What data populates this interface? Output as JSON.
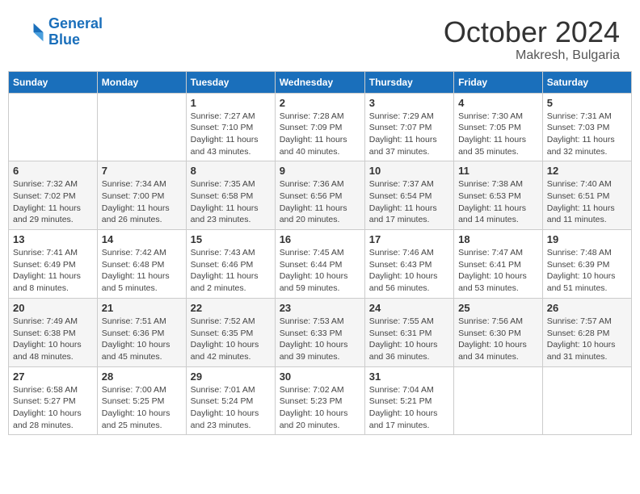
{
  "header": {
    "logo_line1": "General",
    "logo_line2": "Blue",
    "month": "October 2024",
    "location": "Makresh, Bulgaria"
  },
  "weekdays": [
    "Sunday",
    "Monday",
    "Tuesday",
    "Wednesday",
    "Thursday",
    "Friday",
    "Saturday"
  ],
  "weeks": [
    [
      {
        "day": "",
        "info": ""
      },
      {
        "day": "",
        "info": ""
      },
      {
        "day": "1",
        "info": "Sunrise: 7:27 AM\nSunset: 7:10 PM\nDaylight: 11 hours and 43 minutes."
      },
      {
        "day": "2",
        "info": "Sunrise: 7:28 AM\nSunset: 7:09 PM\nDaylight: 11 hours and 40 minutes."
      },
      {
        "day": "3",
        "info": "Sunrise: 7:29 AM\nSunset: 7:07 PM\nDaylight: 11 hours and 37 minutes."
      },
      {
        "day": "4",
        "info": "Sunrise: 7:30 AM\nSunset: 7:05 PM\nDaylight: 11 hours and 35 minutes."
      },
      {
        "day": "5",
        "info": "Sunrise: 7:31 AM\nSunset: 7:03 PM\nDaylight: 11 hours and 32 minutes."
      }
    ],
    [
      {
        "day": "6",
        "info": "Sunrise: 7:32 AM\nSunset: 7:02 PM\nDaylight: 11 hours and 29 minutes."
      },
      {
        "day": "7",
        "info": "Sunrise: 7:34 AM\nSunset: 7:00 PM\nDaylight: 11 hours and 26 minutes."
      },
      {
        "day": "8",
        "info": "Sunrise: 7:35 AM\nSunset: 6:58 PM\nDaylight: 11 hours and 23 minutes."
      },
      {
        "day": "9",
        "info": "Sunrise: 7:36 AM\nSunset: 6:56 PM\nDaylight: 11 hours and 20 minutes."
      },
      {
        "day": "10",
        "info": "Sunrise: 7:37 AM\nSunset: 6:54 PM\nDaylight: 11 hours and 17 minutes."
      },
      {
        "day": "11",
        "info": "Sunrise: 7:38 AM\nSunset: 6:53 PM\nDaylight: 11 hours and 14 minutes."
      },
      {
        "day": "12",
        "info": "Sunrise: 7:40 AM\nSunset: 6:51 PM\nDaylight: 11 hours and 11 minutes."
      }
    ],
    [
      {
        "day": "13",
        "info": "Sunrise: 7:41 AM\nSunset: 6:49 PM\nDaylight: 11 hours and 8 minutes."
      },
      {
        "day": "14",
        "info": "Sunrise: 7:42 AM\nSunset: 6:48 PM\nDaylight: 11 hours and 5 minutes."
      },
      {
        "day": "15",
        "info": "Sunrise: 7:43 AM\nSunset: 6:46 PM\nDaylight: 11 hours and 2 minutes."
      },
      {
        "day": "16",
        "info": "Sunrise: 7:45 AM\nSunset: 6:44 PM\nDaylight: 10 hours and 59 minutes."
      },
      {
        "day": "17",
        "info": "Sunrise: 7:46 AM\nSunset: 6:43 PM\nDaylight: 10 hours and 56 minutes."
      },
      {
        "day": "18",
        "info": "Sunrise: 7:47 AM\nSunset: 6:41 PM\nDaylight: 10 hours and 53 minutes."
      },
      {
        "day": "19",
        "info": "Sunrise: 7:48 AM\nSunset: 6:39 PM\nDaylight: 10 hours and 51 minutes."
      }
    ],
    [
      {
        "day": "20",
        "info": "Sunrise: 7:49 AM\nSunset: 6:38 PM\nDaylight: 10 hours and 48 minutes."
      },
      {
        "day": "21",
        "info": "Sunrise: 7:51 AM\nSunset: 6:36 PM\nDaylight: 10 hours and 45 minutes."
      },
      {
        "day": "22",
        "info": "Sunrise: 7:52 AM\nSunset: 6:35 PM\nDaylight: 10 hours and 42 minutes."
      },
      {
        "day": "23",
        "info": "Sunrise: 7:53 AM\nSunset: 6:33 PM\nDaylight: 10 hours and 39 minutes."
      },
      {
        "day": "24",
        "info": "Sunrise: 7:55 AM\nSunset: 6:31 PM\nDaylight: 10 hours and 36 minutes."
      },
      {
        "day": "25",
        "info": "Sunrise: 7:56 AM\nSunset: 6:30 PM\nDaylight: 10 hours and 34 minutes."
      },
      {
        "day": "26",
        "info": "Sunrise: 7:57 AM\nSunset: 6:28 PM\nDaylight: 10 hours and 31 minutes."
      }
    ],
    [
      {
        "day": "27",
        "info": "Sunrise: 6:58 AM\nSunset: 5:27 PM\nDaylight: 10 hours and 28 minutes."
      },
      {
        "day": "28",
        "info": "Sunrise: 7:00 AM\nSunset: 5:25 PM\nDaylight: 10 hours and 25 minutes."
      },
      {
        "day": "29",
        "info": "Sunrise: 7:01 AM\nSunset: 5:24 PM\nDaylight: 10 hours and 23 minutes."
      },
      {
        "day": "30",
        "info": "Sunrise: 7:02 AM\nSunset: 5:23 PM\nDaylight: 10 hours and 20 minutes."
      },
      {
        "day": "31",
        "info": "Sunrise: 7:04 AM\nSunset: 5:21 PM\nDaylight: 10 hours and 17 minutes."
      },
      {
        "day": "",
        "info": ""
      },
      {
        "day": "",
        "info": ""
      }
    ]
  ]
}
